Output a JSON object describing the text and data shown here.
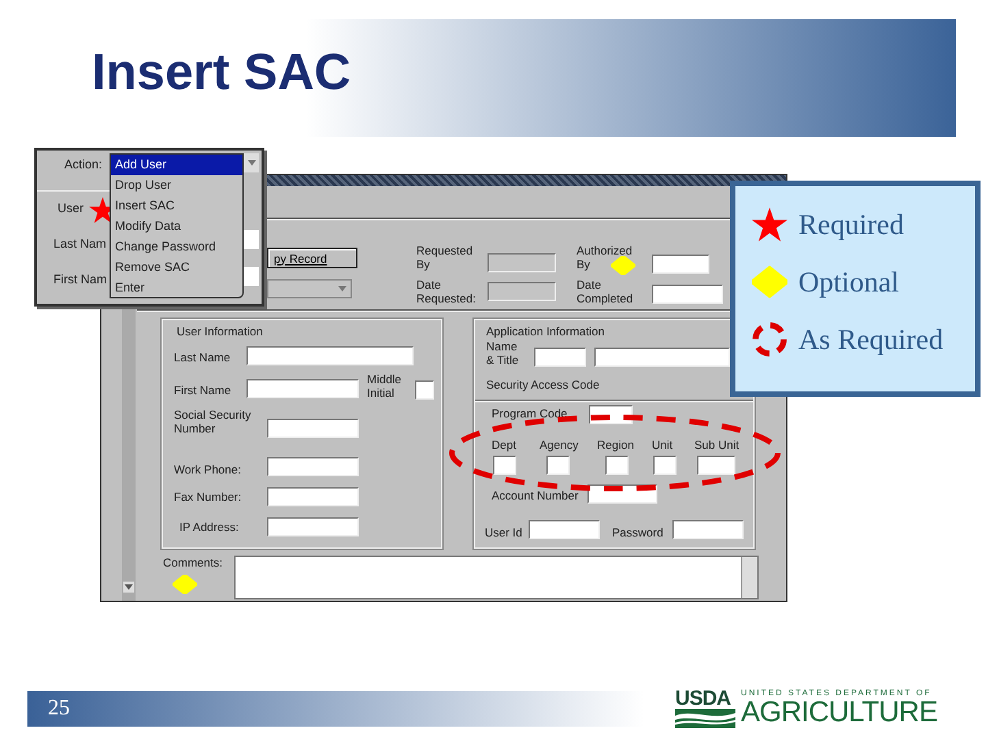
{
  "slide": {
    "title": "Insert SAC",
    "page_number": "25"
  },
  "logo": {
    "acronym": "USDA",
    "line_1": "UNITED STATES DEPARTMENT OF",
    "line_2": "AGRICULTURE"
  },
  "legend": [
    {
      "kind": "star",
      "label": "Required"
    },
    {
      "kind": "diamond",
      "label": "Optional"
    },
    {
      "kind": "dashed-circle",
      "label": "As Required"
    }
  ],
  "action_popup": {
    "label": "Action:",
    "options": [
      {
        "label": "Add User",
        "selected": true
      },
      {
        "label": "Drop User",
        "selected": false
      },
      {
        "label": "Insert SAC",
        "selected": false
      },
      {
        "label": "Modify Data",
        "selected": false
      },
      {
        "label": "Change Password",
        "selected": false
      },
      {
        "label": "Remove SAC",
        "selected": false
      },
      {
        "label": "Enter",
        "selected": false
      }
    ],
    "behind_labels": [
      {
        "label": "User",
        "required": true
      },
      {
        "label": "Last Nam",
        "required": false
      },
      {
        "label": "First Nam",
        "required": false
      }
    ]
  },
  "form": {
    "copy_button": "py Record",
    "request": [
      {
        "label": "Requested By"
      },
      {
        "label": "Date Requested:"
      }
    ],
    "authorize": [
      {
        "label": "Authorized By",
        "optional": true
      },
      {
        "label": "Date Completed",
        "optional": false
      }
    ],
    "user_information": {
      "title": "User Information",
      "fields": [
        {
          "label": "Last Name"
        },
        {
          "label": "First Name"
        },
        {
          "label": "Middle Initial"
        },
        {
          "label": "Social Security Number"
        },
        {
          "label": "Work Phone:"
        },
        {
          "label": "Fax Number:"
        },
        {
          "label": "IP Address:"
        }
      ]
    },
    "application_information": {
      "title": "Application Information",
      "name_title": "Name & Title",
      "security_access_code": "Security Access Code",
      "program_code": "Program Code",
      "codes_as_required": true,
      "codes": [
        {
          "label": "Dept"
        },
        {
          "label": "Agency"
        },
        {
          "label": "Region"
        },
        {
          "label": "Unit"
        },
        {
          "label": "Sub Unit"
        }
      ],
      "account_number": "Account Number",
      "user_id": "User Id",
      "password": "Password"
    },
    "comments": {
      "label": "Comments:",
      "optional": true
    }
  }
}
